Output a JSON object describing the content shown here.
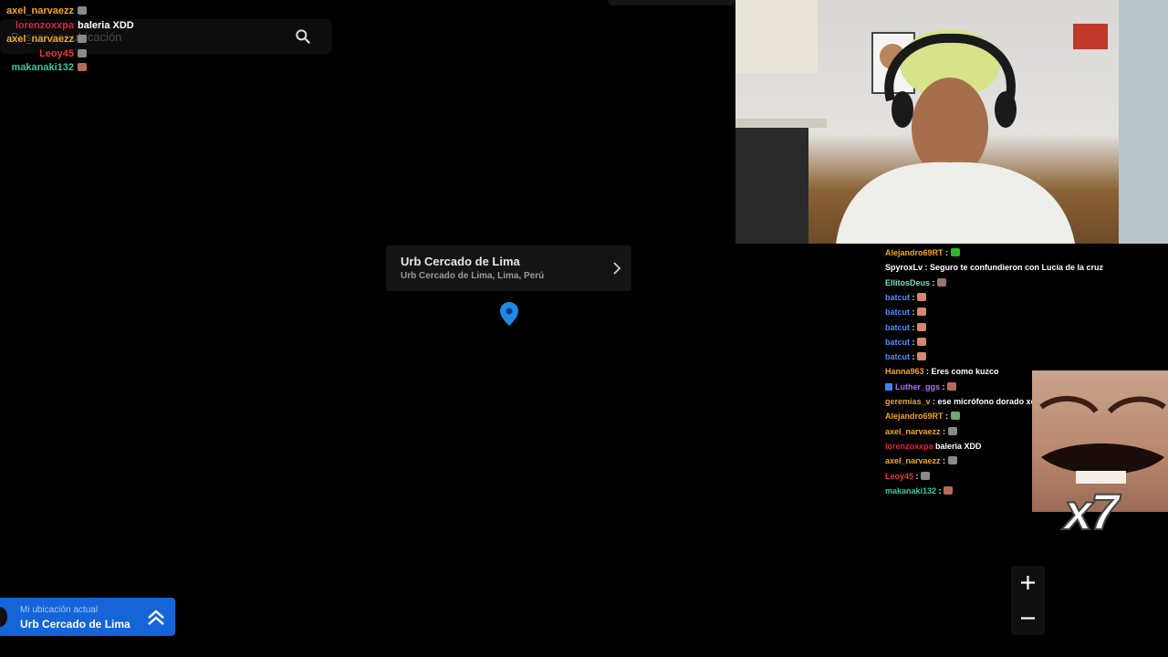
{
  "search": {
    "placeholder": "Buscar por ubicación"
  },
  "left_chat": [
    {
      "user": "axel_narvaezz",
      "color": "#f5a623",
      "msg": "",
      "emote": "#8a8a8a"
    },
    {
      "user": "lorenzoxxpa",
      "color": "#e0213f",
      "msg": "baleria XDD",
      "emote": ""
    },
    {
      "user": "axel_narvaezz",
      "color": "#f5a623",
      "msg": "",
      "emote": "#8a8a8a"
    },
    {
      "user": "Leoy45",
      "color": "#e33b3b",
      "msg": "",
      "emote": "#8a8a8a"
    },
    {
      "user": "makanaki132",
      "color": "#33c8a0",
      "msg": "",
      "emote": "#b86a5a"
    }
  ],
  "popup": {
    "title": "Urb Cercado de Lima",
    "subtitle": "Urb Cercado de Lima, Lima, Perú"
  },
  "location_card": {
    "label": "Mi ubicación actual",
    "value": "Urb Cercado de Lima"
  },
  "right_chat": [
    {
      "user": "Alejandro69RT",
      "color": "#f5a623",
      "msg": "",
      "emote": "#2eb82e",
      "badge": false
    },
    {
      "user": "SpyroxLv",
      "color": "#ffffff",
      "msg": "Seguro te confundieron con Lucía de la cruz",
      "emote": "",
      "badge": false
    },
    {
      "user": "EllitosDeus",
      "color": "#7be0b4",
      "msg": "",
      "emote": "#9a7070",
      "badge": false
    },
    {
      "user": "batcut",
      "color": "#4f8dff",
      "msg": "",
      "emote": "#d48a6a",
      "badge": false
    },
    {
      "user": "batcut",
      "color": "#4f8dff",
      "msg": "",
      "emote": "#d48a6a",
      "badge": false
    },
    {
      "user": "batcut",
      "color": "#4f8dff",
      "msg": "",
      "emote": "#d48a6a",
      "badge": false
    },
    {
      "user": "batcut",
      "color": "#4f8dff",
      "msg": "",
      "emote": "#d48a6a",
      "badge": false
    },
    {
      "user": "batcut",
      "color": "#4f8dff",
      "msg": "",
      "emote": "#d48a6a",
      "badge": false
    },
    {
      "user": "Hanna963",
      "color": "#f5a623",
      "msg": "Eres como kuzco",
      "emote": "",
      "badge": false
    },
    {
      "user": "Luther_ggs",
      "color": "#b06bff",
      "msg": "",
      "emote": "#b86a5a",
      "badge": true
    },
    {
      "user": "geremias_v",
      "color": "#e8a040",
      "msg": "ese micrófono dorado xd",
      "emote": "",
      "badge": false
    },
    {
      "user": "Alejandro69RT",
      "color": "#f5a623",
      "msg": "",
      "emote": "#6fa86f",
      "badge": false
    },
    {
      "user": "axel_narvaezz",
      "color": "#f5a623",
      "msg": "",
      "emote": "#8a8a8a",
      "badge": false
    },
    {
      "user": "lorenzoxxpa",
      "color": "#e0213f",
      "msg": "baleria XDD",
      "emote": "",
      "badge": false
    },
    {
      "user": "axel_narvaezz",
      "color": "#f5a623",
      "msg": "",
      "emote": "#8a8a8a",
      "badge": false
    },
    {
      "user": "Leoy45",
      "color": "#e33b3b",
      "msg": "",
      "emote": "#8a8a8a",
      "badge": false
    },
    {
      "user": "makanaki132",
      "color": "#33c8a0",
      "msg": "",
      "emote": "#b86a5a",
      "badge": false
    }
  ],
  "emote_overlay": {
    "text": "x7"
  },
  "zoom": {
    "in": "+",
    "out": "−"
  }
}
